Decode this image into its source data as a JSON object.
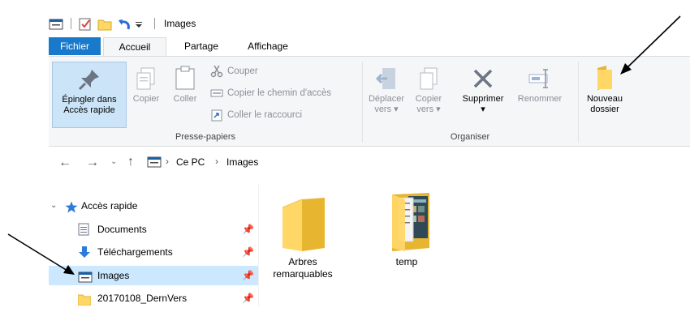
{
  "window": {
    "title": "Images"
  },
  "tabs": {
    "file": "Fichier",
    "home": "Accueil",
    "share": "Partage",
    "view": "Affichage"
  },
  "ribbon": {
    "pin_line1": "Épingler dans",
    "pin_line2": "Accès rapide",
    "copy": "Copier",
    "paste": "Coller",
    "cut": "Couper",
    "copy_path": "Copier le chemin d'accès",
    "paste_shortcut": "Coller le raccourci",
    "clipboard_group": "Presse-papiers",
    "move_line1": "Déplacer",
    "move_line2": "vers",
    "copyto_line1": "Copier",
    "copyto_line2": "vers",
    "delete": "Supprimer",
    "rename": "Renommer",
    "organize_group": "Organiser",
    "newfolder_line1": "Nouveau",
    "newfolder_line2": "dossier"
  },
  "address": {
    "crumb1": "Ce PC",
    "crumb2": "Images"
  },
  "nav": {
    "quick_access": "Accès rapide",
    "items": [
      "Documents",
      "Téléchargements",
      "Images",
      "20170108_DernVers"
    ]
  },
  "content": {
    "items": [
      {
        "line1": "Arbres",
        "line2": "remarquables"
      },
      {
        "line1": "temp",
        "line2": ""
      }
    ]
  },
  "colors": {
    "file_tab": "#1979ca",
    "selection": "#cce8ff",
    "folder": "#ffd767",
    "arrow": "#000000"
  }
}
